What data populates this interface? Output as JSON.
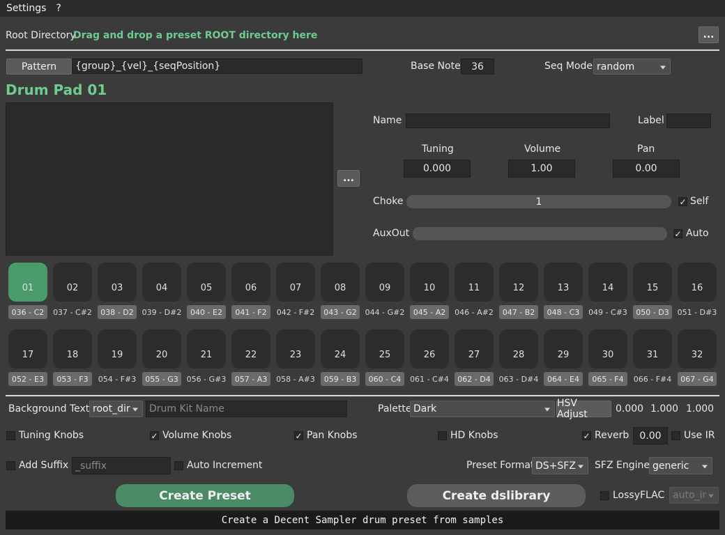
{
  "menu": {
    "items": [
      "Settings",
      "?"
    ]
  },
  "root": {
    "label": "Root Directory",
    "hint": "Drag and drop a preset ROOT directory here",
    "browse_label": "..."
  },
  "pattern": {
    "button_label": "Pattern",
    "value": "{group}_{vel}_{seqPosition}"
  },
  "base_note": {
    "label": "Base Note",
    "value": "36"
  },
  "seq_mode": {
    "label": "Seq Mode",
    "value": "random"
  },
  "pad_title": "Drum Pad 01",
  "sample_browse_label": "...",
  "pad_props": {
    "name_label": "Name",
    "name_value": "",
    "label_label": "Label",
    "label_value": "",
    "tuning_label": "Tuning",
    "tuning_value": "0.000",
    "volume_label": "Volume",
    "volume_value": "1.00",
    "pan_label": "Pan",
    "pan_value": "0.00",
    "choke_label": "Choke",
    "choke_value": "1",
    "self_label": "Self",
    "self_checked": true,
    "auxout_label": "AuxOut",
    "auto_label": "Auto",
    "auto_checked": true
  },
  "pads": [
    {
      "num": "01",
      "note": "036 - C2",
      "active": true
    },
    {
      "num": "02",
      "note": "037 - C#2"
    },
    {
      "num": "03",
      "note": "038 - D2"
    },
    {
      "num": "04",
      "note": "039 - D#2"
    },
    {
      "num": "05",
      "note": "040 - E2"
    },
    {
      "num": "06",
      "note": "041 - F2"
    },
    {
      "num": "07",
      "note": "042 - F#2"
    },
    {
      "num": "08",
      "note": "043 - G2"
    },
    {
      "num": "09",
      "note": "044 - G#2"
    },
    {
      "num": "10",
      "note": "045 - A2"
    },
    {
      "num": "11",
      "note": "046 - A#2"
    },
    {
      "num": "12",
      "note": "047 - B2"
    },
    {
      "num": "13",
      "note": "048 - C3"
    },
    {
      "num": "14",
      "note": "049 - C#3"
    },
    {
      "num": "15",
      "note": "050 - D3"
    },
    {
      "num": "16",
      "note": "051 - D#3"
    },
    {
      "num": "17",
      "note": "052 - E3"
    },
    {
      "num": "18",
      "note": "053 - F3"
    },
    {
      "num": "19",
      "note": "054 - F#3"
    },
    {
      "num": "20",
      "note": "055 - G3"
    },
    {
      "num": "21",
      "note": "056 - G#3"
    },
    {
      "num": "22",
      "note": "057 - A3"
    },
    {
      "num": "23",
      "note": "058 - A#3"
    },
    {
      "num": "24",
      "note": "059 - B3"
    },
    {
      "num": "25",
      "note": "060 - C4"
    },
    {
      "num": "26",
      "note": "061 - C#4"
    },
    {
      "num": "27",
      "note": "062 - D4"
    },
    {
      "num": "28",
      "note": "063 - D#4"
    },
    {
      "num": "29",
      "note": "064 - E4"
    },
    {
      "num": "30",
      "note": "065 - F4"
    },
    {
      "num": "31",
      "note": "066 - F#4"
    },
    {
      "num": "32",
      "note": "067 - G4"
    }
  ],
  "bg_text": {
    "label": "Background Text",
    "combo_value": "root_dir",
    "kit_placeholder": "Drum Kit Name"
  },
  "palette": {
    "label": "Palette",
    "value": "Dark",
    "hsv_label": "HSV Adjust",
    "h": "0.000",
    "s": "1.000",
    "v": "1.000"
  },
  "options": {
    "tuning_knobs": {
      "label": "Tuning Knobs",
      "checked": false
    },
    "volume_knobs": {
      "label": "Volume Knobs",
      "checked": true
    },
    "pan_knobs": {
      "label": "Pan Knobs",
      "checked": true
    },
    "hd_knobs": {
      "label": "HD Knobs",
      "checked": false
    },
    "reverb": {
      "label": "Reverb",
      "checked": true,
      "value": "0.00"
    },
    "use_ir": {
      "label": "Use IR",
      "checked": false
    },
    "add_suffix": {
      "label": "Add Suffix",
      "checked": false,
      "placeholder": "_suffix"
    },
    "auto_increment": {
      "label": "Auto Increment",
      "checked": false
    }
  },
  "preset_format": {
    "label": "Preset Format",
    "value": "DS+SFZ"
  },
  "sfz_engine": {
    "label": "SFZ Engine",
    "value": "generic"
  },
  "actions": {
    "create_preset": "Create Preset",
    "create_dslibrary": "Create dslibrary",
    "lossyflac_label": "LossyFLAC",
    "lossyflac_checked": false,
    "lossy_combo": "auto_ir"
  },
  "status_text": "Create a Decent Sampler drum preset from samples",
  "colors": {
    "accent_green": "#4a9a6c",
    "title_green": "#6fcb8f",
    "background": "#3b3b3b"
  }
}
